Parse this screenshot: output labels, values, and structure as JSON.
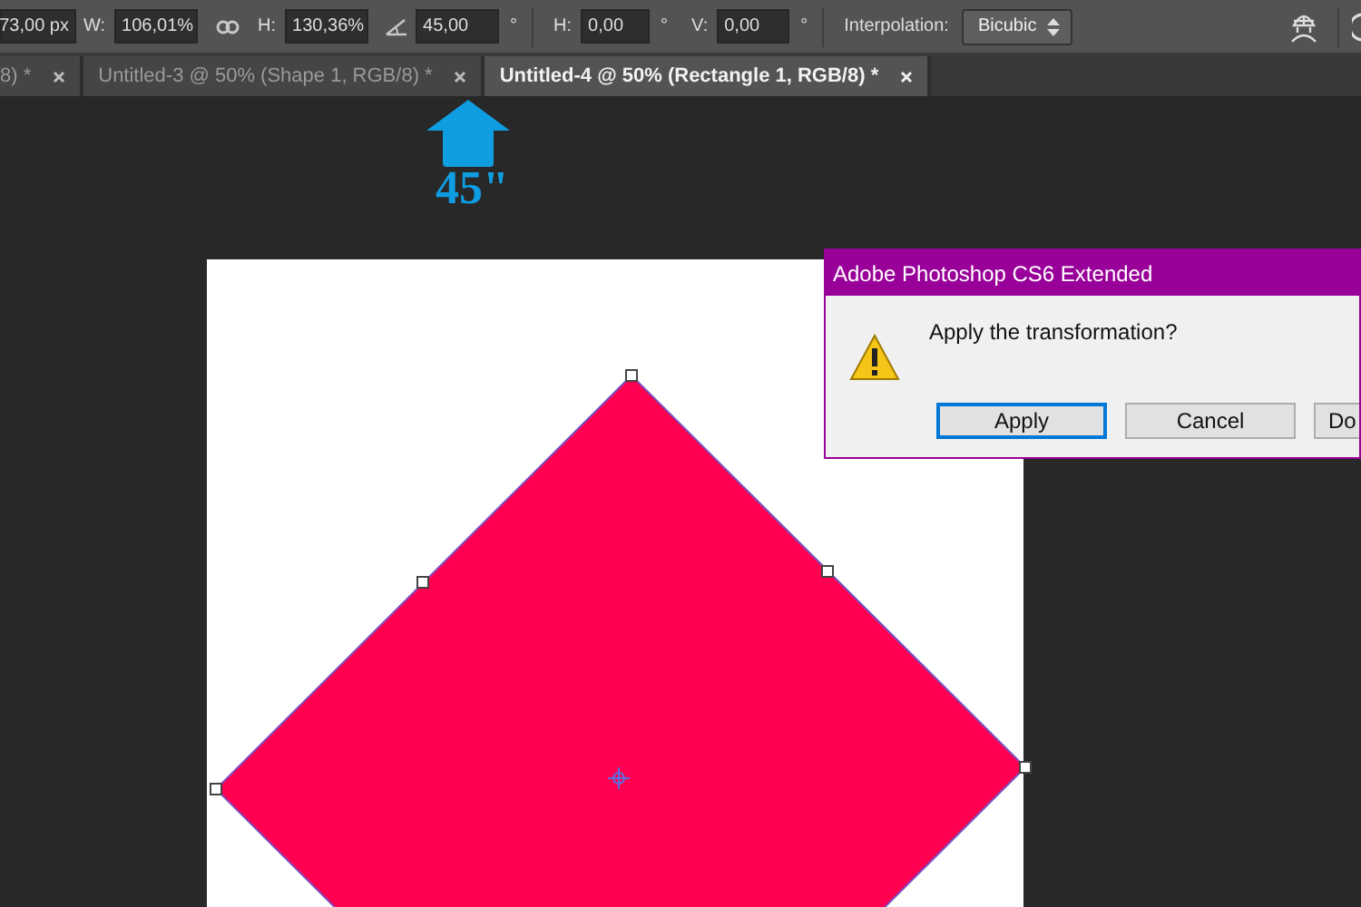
{
  "options_bar": {
    "x_value": "73,00 px",
    "width_label": "W:",
    "width_value": "106,01%",
    "height_label": "H:",
    "height_value": "130,36%",
    "angle_value": "45,00",
    "angle_unit": "°",
    "hskew_label": "H:",
    "hskew_value": "0,00",
    "hskew_unit": "°",
    "vskew_label": "V:",
    "vskew_value": "0,00",
    "vskew_unit": "°",
    "interpolation_label": "Interpolation:",
    "interpolation_value": "Bicubic"
  },
  "tabs": [
    {
      "label": "8) *",
      "selected": false
    },
    {
      "label": "Untitled-3 @ 50% (Shape 1, RGB/8) *",
      "selected": false
    },
    {
      "label": "Untitled-4 @ 50% (Rectangle 1, RGB/8) *",
      "selected": true
    }
  ],
  "annotation": {
    "label": "45\""
  },
  "dialog": {
    "title": "Adobe Photoshop CS6 Extended",
    "message": "Apply the transformation?",
    "buttons": [
      {
        "label": "Apply",
        "selected": true
      },
      {
        "label": "Cancel",
        "selected": false
      },
      {
        "label": "Do",
        "selected": false
      }
    ]
  }
}
